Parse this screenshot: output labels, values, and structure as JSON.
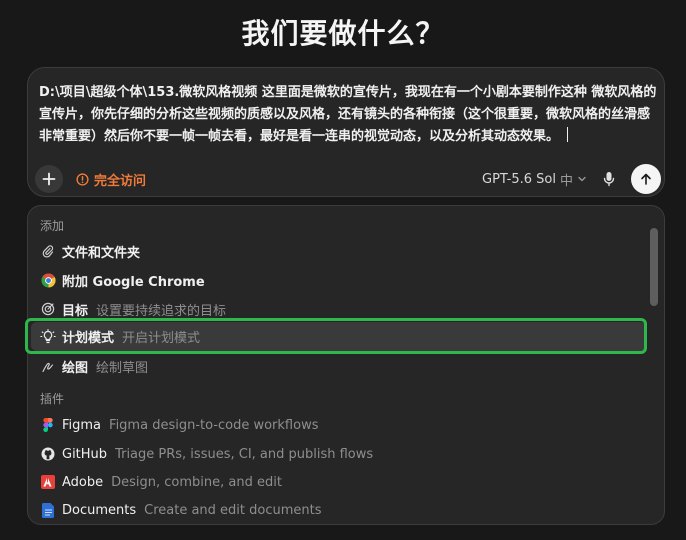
{
  "page_title": "我们要做什么？",
  "composer": {
    "text": "D:\\项目\\超级个体\\153.微软风格视频 这里面是微软的宣传片，我现在有一个小剧本要制作这种 微软风格的宣传片，你先仔细的分析这些视频的质感以及风格，还有镜头的各种衔接（这个很重要，微软风格的丝滑感非常重要）然后你不要一帧一帧去看，最好是看一连串的视觉动态，以及分析其动态效果。",
    "access_label": "完全访问",
    "model_label": "GPT-5.6 Sol",
    "effort_label": "中"
  },
  "menu": {
    "section_add": "添加",
    "items": [
      {
        "label": "文件和文件夹",
        "desc": ""
      },
      {
        "label": "附加 Google Chrome",
        "desc": ""
      },
      {
        "label": "目标",
        "desc": "设置要持续追求的目标"
      },
      {
        "label": "计划模式",
        "desc": "开启计划模式"
      },
      {
        "label": "绘图",
        "desc": "绘制草图"
      }
    ],
    "section_plugins": "插件",
    "plugins": [
      {
        "label": "Figma",
        "desc": "Figma design-to-code workflows"
      },
      {
        "label": "GitHub",
        "desc": "Triage PRs, issues, CI, and publish flows"
      },
      {
        "label": "Adobe",
        "desc": "Design, combine, and edit"
      },
      {
        "label": "Documents",
        "desc": "Create and edit documents"
      }
    ]
  },
  "colors": {
    "background": "#181818",
    "panel": "#262626",
    "access_orange": "#f07a3a",
    "focus_green": "#2fb84a",
    "highlight_row": "#3a3a3a"
  },
  "icons": [
    "plus-icon",
    "warning-circle-icon",
    "chevron-down-icon",
    "microphone-icon",
    "arrow-up-icon",
    "paperclip-icon",
    "chrome-icon",
    "target-icon",
    "lightbulb-icon",
    "pen-icon",
    "figma-icon",
    "github-icon",
    "adobe-icon",
    "document-icon"
  ]
}
